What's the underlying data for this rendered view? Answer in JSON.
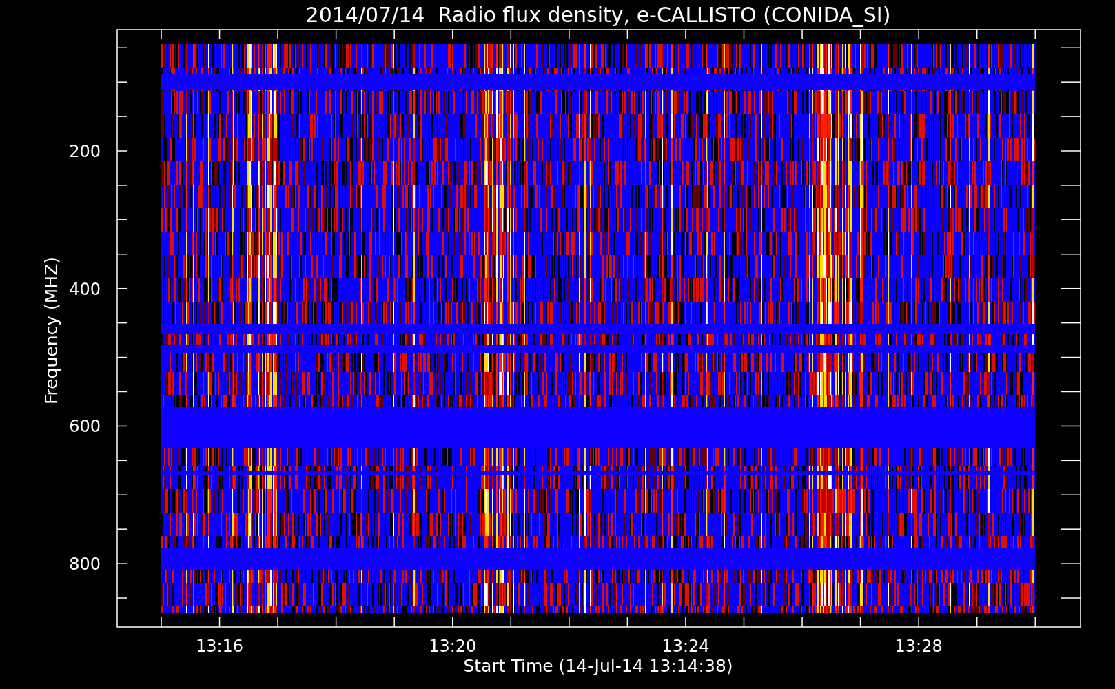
{
  "title": "2014/07/14  Radio flux density, e-CALLISTO (CONIDA_SI)",
  "y_axis": {
    "label": "Frequency (MHZ)",
    "tick_labels": [
      "200",
      "400",
      "600",
      "800"
    ]
  },
  "x_axis": {
    "label": "Start Time (14-Jul-14 13:14:38)",
    "tick_labels": [
      "13:16",
      "13:20",
      "13:24",
      "13:28"
    ]
  }
}
